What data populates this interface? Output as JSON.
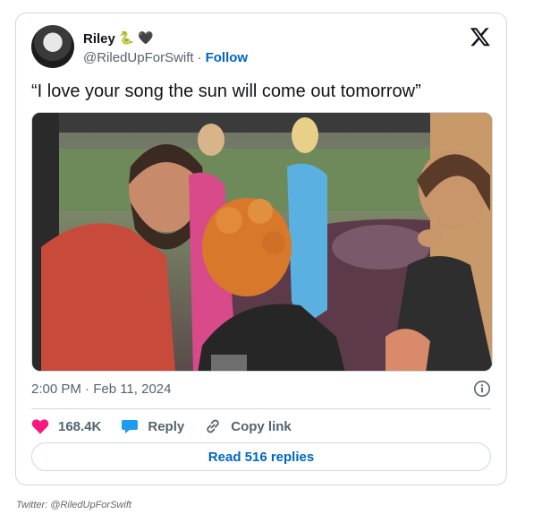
{
  "tweet": {
    "display_name": "Riley",
    "emojis": {
      "snake": "🐍",
      "heart": "🖤"
    },
    "handle": "@RiledUpForSwift",
    "separator": "·",
    "follow_label": "Follow",
    "text": "“I love your song the sun will come out tomorrow”",
    "timestamp": "2:00 PM · Feb 11, 2024",
    "like_count": "168.4K",
    "reply_label": "Reply",
    "copy_link_label": "Copy link",
    "read_replies_label": "Read 516 replies"
  },
  "credit": "Twitter: @RiledUpForSwift",
  "icons": {
    "brand": "x-logo-icon",
    "info": "info-icon",
    "like": "heart-icon",
    "reply": "reply-bubble-icon",
    "link": "link-icon"
  },
  "colors": {
    "text_primary": "#0f1419",
    "text_secondary": "#536471",
    "link_blue": "#0066c0",
    "like_pink": "#f91880",
    "reply_blue": "#1d9bf0",
    "border": "#cfd9de"
  }
}
